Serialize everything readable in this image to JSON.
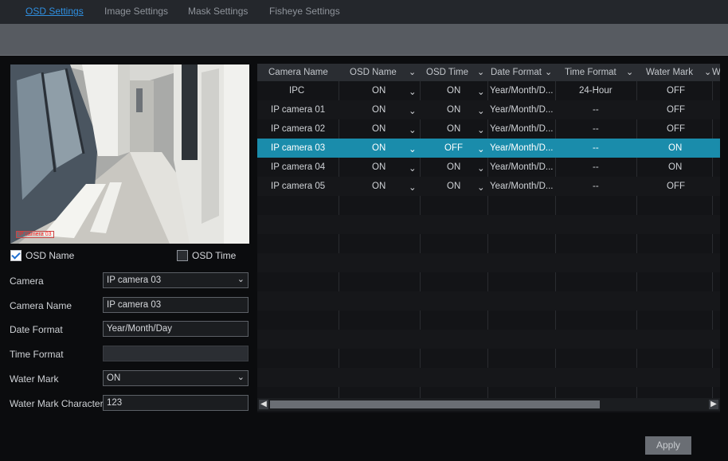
{
  "tabs": [
    {
      "label": "OSD Settings",
      "active": true
    },
    {
      "label": "Image Settings"
    },
    {
      "label": "Mask Settings"
    },
    {
      "label": "Fisheye Settings"
    }
  ],
  "preview": {
    "osd_overlay_text": "IP camera 03"
  },
  "checkboxes": {
    "osd_name": {
      "label": "OSD Name",
      "checked": true
    },
    "osd_time": {
      "label": "OSD Time",
      "checked": false
    }
  },
  "form": {
    "camera": {
      "label": "Camera",
      "value": "IP camera 03"
    },
    "camera_name": {
      "label": "Camera Name",
      "value": "IP camera 03"
    },
    "date_format": {
      "label": "Date Format",
      "value": "Year/Month/Day"
    },
    "time_format": {
      "label": "Time Format",
      "value": ""
    },
    "water_mark": {
      "label": "Water Mark",
      "value": "ON"
    },
    "water_mark_character": {
      "label": "Water Mark Character",
      "value": "123"
    }
  },
  "table": {
    "headers": [
      "Camera Name",
      "OSD Name",
      "OSD Time",
      "Date Format",
      "Time Format",
      "Water Mark",
      "Wa"
    ],
    "rows": [
      [
        "IPC",
        "ON",
        "ON",
        "Year/Month/D...",
        "24-Hour",
        "OFF"
      ],
      [
        "IP camera 01",
        "ON",
        "ON",
        "Year/Month/D...",
        "--",
        "OFF"
      ],
      [
        "IP camera 02",
        "ON",
        "ON",
        "Year/Month/D...",
        "--",
        "OFF"
      ],
      [
        "IP camera 03",
        "ON",
        "OFF",
        "Year/Month/D...",
        "--",
        "ON"
      ],
      [
        "IP camera 04",
        "ON",
        "ON",
        "Year/Month/D...",
        "--",
        "ON"
      ],
      [
        "IP camera 05",
        "ON",
        "ON",
        "Year/Month/D...",
        "--",
        "OFF"
      ]
    ],
    "selected_row": 3
  },
  "buttons": {
    "apply": "Apply"
  },
  "colors": {
    "accent": "#2f8fe0",
    "selected_row": "#1a8cab"
  }
}
